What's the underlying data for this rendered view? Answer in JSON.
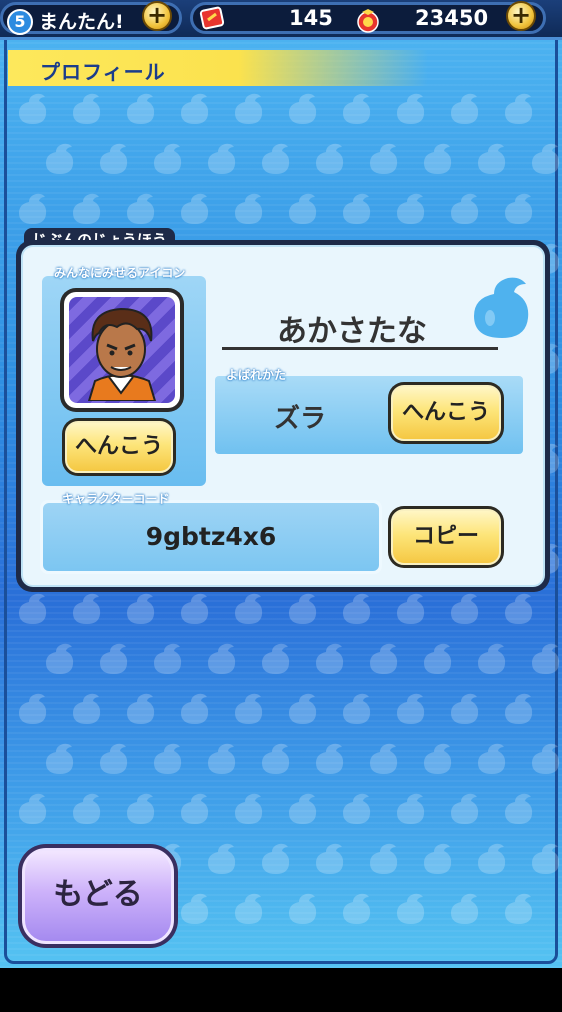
{
  "topbar": {
    "level": "5",
    "difficulty_label": "まんたん!",
    "ticket_count": "145",
    "money": "23450",
    "plus_symbol": "+"
  },
  "header": {
    "title": "プロフィール"
  },
  "profile": {
    "section_title": "じぶんのじょうほう",
    "icon_label": "みんなにみせるアイコン",
    "icon_change_button": "へんこう",
    "player_name": "あかさたな",
    "title_label": "よばれかた",
    "title_value": "ズラ",
    "title_change_button": "へんこう",
    "code_label": "キャラクターコード",
    "character_code": "9gbtz4x6",
    "copy_button": "コピー"
  },
  "footer": {
    "back_button": "もどる"
  },
  "colors": {
    "accent_yellow": "#fde57a",
    "panel_dark": "#1e2a48",
    "background_blue": "#2f8fe2",
    "back_button_purple": "#cdb2fa"
  }
}
